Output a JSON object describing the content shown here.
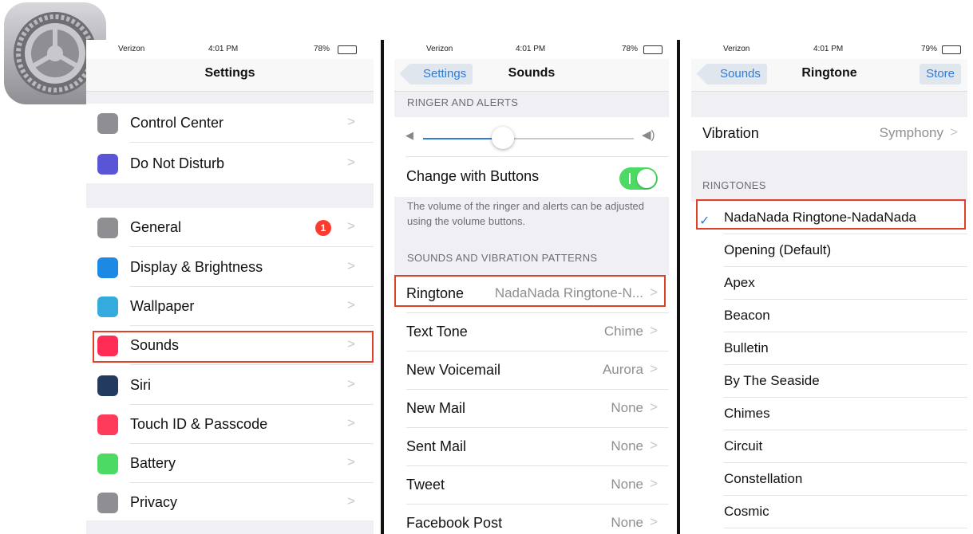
{
  "app_icon": {
    "name": "settings-gear"
  },
  "colors": {
    "accent": "#2f7bd8",
    "highlight": "#e0402a",
    "toggle_on": "#4cd964",
    "badge": "#ff3b30"
  },
  "panel1": {
    "status": {
      "carrier": "Verizon",
      "time": "4:01 PM",
      "battery": "78%"
    },
    "title": "Settings",
    "items": [
      {
        "label": "Control Center",
        "icon": "toggles-icon",
        "color": "#8e8e93"
      },
      {
        "label": "Do Not Disturb",
        "icon": "moon-icon",
        "color": "#5856d6"
      },
      {
        "label": "General",
        "icon": "gear-icon",
        "color": "#8e8e93",
        "badge": "1"
      },
      {
        "label": "Display & Brightness",
        "icon": "text-size-icon",
        "color": "#1e88e5"
      },
      {
        "label": "Wallpaper",
        "icon": "flower-icon",
        "color": "#35aadc"
      },
      {
        "label": "Sounds",
        "icon": "speaker-icon",
        "color": "#ff2d55"
      },
      {
        "label": "Siri",
        "icon": "siri-icon",
        "color": "#223a5e"
      },
      {
        "label": "Touch ID & Passcode",
        "icon": "fingerprint-icon",
        "color": "#ff3b5c"
      },
      {
        "label": "Battery",
        "icon": "battery-icon",
        "color": "#4cd964"
      },
      {
        "label": "Privacy",
        "icon": "hand-icon",
        "color": "#8e8e93"
      }
    ]
  },
  "panel2": {
    "status": {
      "carrier": "Verizon",
      "time": "4:01 PM",
      "battery": "78%"
    },
    "back": "Settings",
    "title": "Sounds",
    "section_ringer": "RINGER AND ALERTS",
    "volume_level": 0.38,
    "change_with_buttons": {
      "label": "Change with Buttons",
      "on": true
    },
    "footer": "The volume of the ringer and alerts can be adjusted using the volume buttons.",
    "section_patterns": "SOUNDS AND VIBRATION PATTERNS",
    "rows": [
      {
        "label": "Ringtone",
        "value": "NadaNada Ringtone-N..."
      },
      {
        "label": "Text Tone",
        "value": "Chime"
      },
      {
        "label": "New Voicemail",
        "value": "Aurora"
      },
      {
        "label": "New Mail",
        "value": "None"
      },
      {
        "label": "Sent Mail",
        "value": "None"
      },
      {
        "label": "Tweet",
        "value": "None"
      },
      {
        "label": "Facebook Post",
        "value": "None"
      }
    ]
  },
  "panel3": {
    "status": {
      "carrier": "Verizon",
      "time": "4:01 PM",
      "battery": "79%"
    },
    "back": "Sounds",
    "title": "Ringtone",
    "store": "Store",
    "vibration": {
      "label": "Vibration",
      "value": "Symphony"
    },
    "section": "RINGTONES",
    "selected": "NadaNada Ringtone-NadaNada",
    "ringtones": [
      "Opening (Default)",
      "Apex",
      "Beacon",
      "Bulletin",
      "By The Seaside",
      "Chimes",
      "Circuit",
      "Constellation",
      "Cosmic"
    ]
  }
}
